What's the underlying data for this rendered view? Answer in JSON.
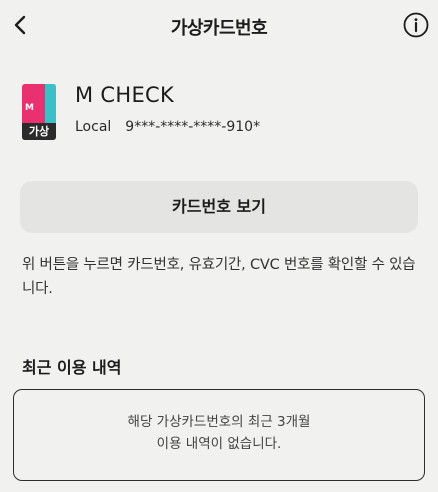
{
  "header": {
    "title": "가상카드번호",
    "back_icon": "chevron-left-icon",
    "info_icon": "info-circle-icon"
  },
  "card": {
    "thumb_letter": "M",
    "thumb_badge": "가상",
    "name": "M CHECK",
    "region": "Local",
    "masked_number": "9***-****-****-910*",
    "colors": {
      "pink": "#e8316e",
      "teal": "#3cc0c7",
      "badge": "#2b2b2b"
    }
  },
  "view_button": {
    "label": "카드번호 보기"
  },
  "help_text": "위 버튼을 누르면 카드번호, 유효기간, CVC 번호를 확인할 수 있습니다.",
  "recent": {
    "title": "최근 이용 내역",
    "empty_line1": "해당 가상카드번호의 최근 3개월",
    "empty_line2": "이용 내역이 없습니다."
  }
}
